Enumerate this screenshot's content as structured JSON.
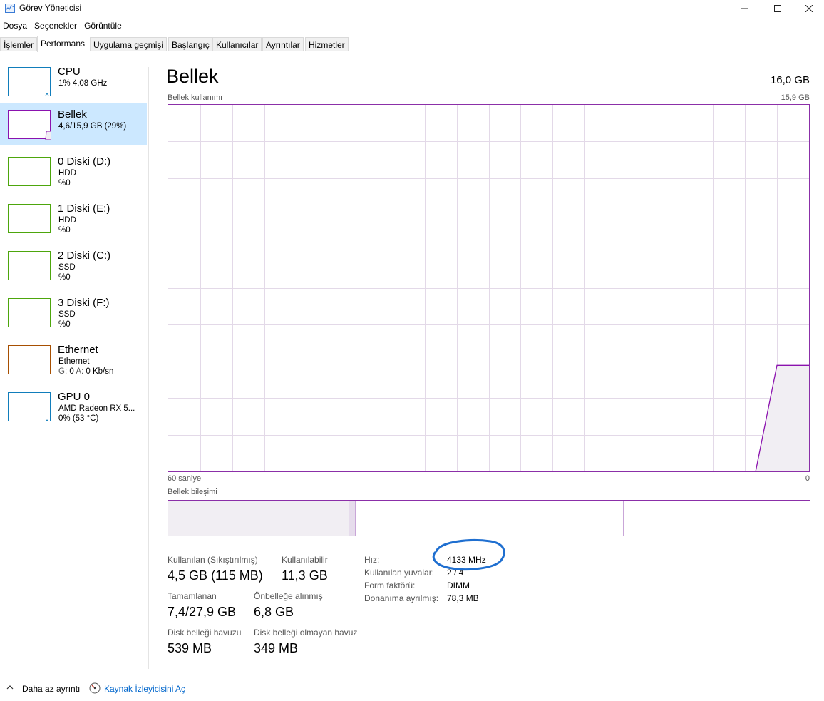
{
  "window": {
    "title": "Görev Yöneticisi",
    "controls": {
      "minimize": "minimize-icon",
      "maximize": "maximize-icon",
      "close": "close-icon"
    }
  },
  "menu": [
    "Dosya",
    "Seçenekler",
    "Görüntüle"
  ],
  "tabs": [
    "İşlemler",
    "Performans",
    "Uygulama geçmişi",
    "Başlangıç",
    "Kullanıcılar",
    "Ayrıntılar",
    "Hizmetler"
  ],
  "active_tab": "Performans",
  "sidebar": [
    {
      "title": "CPU",
      "line1": "1% 4,08 GHz",
      "line2": "",
      "color": "#117dbb"
    },
    {
      "title": "Bellek",
      "line1": "4,6/15,9 GB (29%)",
      "line2": "",
      "color": "#8b12ae",
      "usage_fraction": 0.29
    },
    {
      "title": "0 Diski (D:)",
      "line1": "HDD",
      "line2": "%0",
      "color": "#4da60c"
    },
    {
      "title": "1 Diski (E:)",
      "line1": "HDD",
      "line2": "%0",
      "color": "#4da60c"
    },
    {
      "title": "2 Diski (C:)",
      "line1": "SSD",
      "line2": "%0",
      "color": "#4da60c"
    },
    {
      "title": "3 Diski (F:)",
      "line1": "SSD",
      "line2": "%0",
      "color": "#4da60c"
    },
    {
      "title": "Ethernet",
      "line1": "Ethernet",
      "line2_label_g": "G:",
      "line2_value_g": "0",
      "line2_label_a": "A:",
      "line2_value_a": "0 Kb/sn",
      "color": "#a74f01"
    },
    {
      "title": "GPU 0",
      "line1": "AMD Radeon RX 5...",
      "line2": "0% (53 °C)",
      "color": "#117dbb"
    }
  ],
  "memory": {
    "title": "Bellek",
    "total": "16,0 GB",
    "usage_label": "Bellek kullanımı",
    "usage_max": "15,9 GB",
    "axis_left": "60 saniye",
    "axis_right": "0",
    "composition_label": "Bellek bileşimi",
    "accent": "#8b12ae",
    "fill": "#f1eef3",
    "composition_fractions": {
      "in_use": 0.281,
      "modified": 0.01,
      "standby": 0.418,
      "free": 0.291
    },
    "stats": {
      "used_label": "Kullanılan (Sıkıştırılmış)",
      "used_value": "4,5 GB (115 MB)",
      "available_label": "Kullanılabilir",
      "available_value": "11,3 GB",
      "committed_label": "Tamamlanan",
      "committed_value": "7,4/27,9 GB",
      "cached_label": "Önbelleğe alınmış",
      "cached_value": "6,8 GB",
      "paged_label": "Disk belleği havuzu",
      "paged_value": "539 MB",
      "nonpaged_label": "Disk belleği olmayan havuz",
      "nonpaged_value": "349 MB"
    },
    "details": [
      {
        "label": "Hız:",
        "value": "4133 MHz"
      },
      {
        "label": "Kullanılan yuvalar:",
        "value": "2 / 4"
      },
      {
        "label": "Form faktörü:",
        "value": "DIMM"
      },
      {
        "label": "Donanıma ayrılmış:",
        "value": "78,3 MB"
      }
    ]
  },
  "chart_data": {
    "type": "area",
    "title": "Bellek kullanımı",
    "x": [
      60,
      5,
      3,
      0
    ],
    "series": [
      {
        "values": [
          0,
          0,
          4.6,
          4.6
        ]
      }
    ],
    "ylim": [
      0,
      15.9
    ],
    "xlim": [
      60,
      0
    ],
    "grid": true
  },
  "footer": {
    "less_details": "Daha az ayrıntı",
    "open_monitor": "Kaynak İzleyicisini Aç"
  }
}
